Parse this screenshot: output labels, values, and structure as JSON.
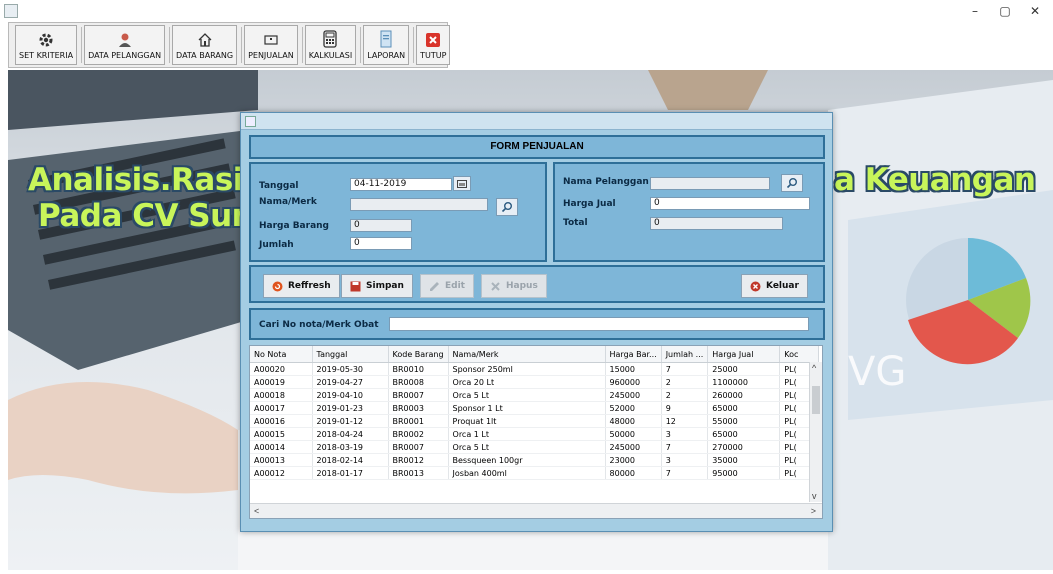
{
  "window": {
    "controls": {
      "minimize": "–",
      "maximize": "▢",
      "close": "✕"
    }
  },
  "toolbar": {
    "buttons": [
      {
        "label": "SET KRITERIA",
        "icon": "gear-icon"
      },
      {
        "label": "DATA PELANGGAN",
        "icon": "user-icon"
      },
      {
        "label": "DATA BARANG",
        "icon": "home-icon"
      },
      {
        "label": "PENJUALAN",
        "icon": "receipt-icon"
      },
      {
        "label": "KALKULASI",
        "icon": "calculator-icon"
      },
      {
        "label": "LAPORAN",
        "icon": "document-icon"
      },
      {
        "label": "TUTUP",
        "icon": "close-icon"
      }
    ]
  },
  "background": {
    "text_left_line1": "Analisis.Rasio",
    "text_left_line2": "Pada CV Sumb",
    "text_right": "a Keuangan"
  },
  "form": {
    "title": "FORM PENJUALAN",
    "left": {
      "tanggal_label": "Tanggal",
      "tanggal_value": "04-11-2019",
      "nama_merk_label": "Nama/Merk",
      "nama_merk_value": "",
      "harga_barang_label": "Harga Barang",
      "harga_barang_value": "0",
      "jumlah_label": "Jumlah",
      "jumlah_value": "0"
    },
    "right": {
      "nama_pelanggan_label": "Nama Pelanggan",
      "nama_pelanggan_value": "",
      "harga_jual_label": "Harga Jual",
      "harga_jual_value": "0",
      "total_label": "Total",
      "total_value": "0"
    },
    "actions": {
      "refresh": "Reffresh",
      "simpan": "Simpan",
      "edit": "Edit",
      "hapus": "Hapus",
      "keluar": "Keluar"
    },
    "search": {
      "label": "Cari No nota/Merk Obat",
      "value": ""
    }
  },
  "table": {
    "columns": [
      "No Nota",
      "Tanggal",
      "Kode Barang",
      "Nama/Merk",
      "Harga Bar...",
      "Jumlah ...",
      "Harga Jual",
      "Koc"
    ],
    "rows": [
      [
        "A00020",
        "2019-05-30",
        "BR0010",
        "Sponsor 250ml",
        "15000",
        "7",
        "25000",
        "PL("
      ],
      [
        "A00019",
        "2019-04-27",
        "BR0008",
        "Orca 20 Lt",
        "960000",
        "2",
        "1100000",
        "PL("
      ],
      [
        "A00018",
        "2019-04-10",
        "BR0007",
        "Orca 5 Lt",
        "245000",
        "2",
        "260000",
        "PL("
      ],
      [
        "A00017",
        "2019-01-23",
        "BR0003",
        "Sponsor 1 Lt",
        "52000",
        "9",
        "65000",
        "PL("
      ],
      [
        "A00016",
        "2019-01-12",
        "BR0001",
        "Proquat 1lt",
        "48000",
        "12",
        "55000",
        "PL("
      ],
      [
        "A00015",
        "2018-04-24",
        "BR0002",
        "Orca 1 Lt",
        "50000",
        "3",
        "65000",
        "PL("
      ],
      [
        "A00014",
        "2018-03-19",
        "BR0007",
        "Orca 5 Lt",
        "245000",
        "7",
        "270000",
        "PL("
      ],
      [
        "A00013",
        "2018-02-14",
        "BR0012",
        "Bessqueen 100gr",
        "23000",
        "3",
        "35000",
        "PL("
      ],
      [
        "A00012",
        "2018-01-17",
        "BR0013",
        "Josban 400ml",
        "80000",
        "7",
        "95000",
        "PL("
      ]
    ],
    "scroll": {
      "up": "^",
      "down": "v",
      "left": "<",
      "right": ">"
    }
  }
}
